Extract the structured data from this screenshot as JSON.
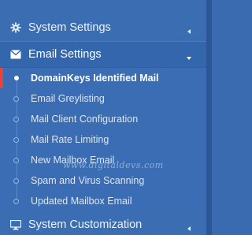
{
  "menu": {
    "system_settings": {
      "label": "System Settings",
      "icon": "gear-icon",
      "state": "collapsed"
    },
    "email_settings": {
      "label": "Email Settings",
      "icon": "envelope-icon",
      "state": "expanded",
      "items": [
        {
          "label": "DomainKeys Identified Mail",
          "active": true
        },
        {
          "label": "Email Greylisting"
        },
        {
          "label": "Mail Client Configuration"
        },
        {
          "label": "Mail Rate Limiting"
        },
        {
          "label": "New Mailbox Email"
        },
        {
          "label": "Spam and Virus Scanning"
        },
        {
          "label": "Updated Mailbox Email"
        }
      ]
    },
    "system_customization": {
      "label": "System Customization",
      "icon": "monitor-icon",
      "state": "collapsed"
    }
  },
  "watermark": "www.digitaldevs.com",
  "colors": {
    "sidebar_bg": "#3b6db3",
    "active_indicator": "#e8423a",
    "text": "#ffffff"
  }
}
